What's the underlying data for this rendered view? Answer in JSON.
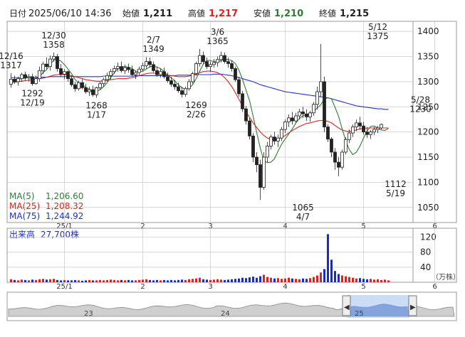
{
  "header": {
    "date_label": "日付",
    "date_value": "2025/06/10 14:36",
    "open_label": "始値",
    "open_value": "1,211",
    "high_label": "高値",
    "high_value": "1,217",
    "low_label": "安値",
    "low_value": "1,210",
    "close_label": "終値",
    "close_value": "1,215"
  },
  "colors": {
    "up": "#e0201c",
    "down": "#1a2dbf",
    "ma5": "#2e7d32",
    "ma25": "#e0201c",
    "ma75": "#2030d0",
    "grid": "#c8c8c8",
    "volume": "#e0201c",
    "volume_down": "#1a2dbf"
  },
  "legend": [
    {
      "label": "MA(5)",
      "value": "1,206.60",
      "color": "#2e7d32"
    },
    {
      "label": "MA(25)",
      "value": "1,208.32",
      "color": "#e0201c"
    },
    {
      "label": "MA(75)",
      "value": "1,244.92",
      "color": "#2030d0"
    }
  ],
  "price_axis": {
    "ticks": [
      "1400",
      "1350",
      "1300",
      "1250",
      "1200",
      "1150",
      "1100",
      "1050"
    ]
  },
  "month_labels": [
    "25/1",
    "2",
    "3",
    "4",
    "5",
    "6"
  ],
  "volume_panel": {
    "title": "出来高",
    "value": "27,700株",
    "ticks": [
      "120",
      "80",
      "40"
    ],
    "unit": "（万株）"
  },
  "navigator": {
    "labels": [
      "23",
      "24",
      "25"
    ]
  },
  "chart_data": {
    "type": "candlestick",
    "price_range": [
      1020,
      1420
    ],
    "volume_range": [
      0,
      140
    ],
    "months": [
      {
        "label": "25/1",
        "day": 15
      },
      {
        "label": "2",
        "day": 37
      },
      {
        "label": "3",
        "day": 56
      },
      {
        "label": "4",
        "day": 77
      },
      {
        "label": "5",
        "day": 99
      },
      {
        "label": "6",
        "day": 119
      }
    ],
    "annotations": [
      {
        "day": 0,
        "price": 1317,
        "text": [
          "12/16",
          "1317"
        ],
        "pos": "above"
      },
      {
        "day": 6,
        "price": 1292,
        "text": [
          "1292",
          "12/19"
        ],
        "pos": "below"
      },
      {
        "day": 12,
        "price": 1358,
        "text": [
          "12/30",
          "1358"
        ],
        "pos": "above"
      },
      {
        "day": 24,
        "price": 1268,
        "text": [
          "1268",
          "1/17"
        ],
        "pos": "below"
      },
      {
        "day": 40,
        "price": 1349,
        "text": [
          "2/7",
          "1349"
        ],
        "pos": "above"
      },
      {
        "day": 52,
        "price": 1269,
        "text": [
          "1269",
          "2/26"
        ],
        "pos": "below"
      },
      {
        "day": 58,
        "price": 1365,
        "text": [
          "3/6",
          "1365"
        ],
        "pos": "above"
      },
      {
        "day": 82,
        "price": 1065,
        "text": [
          "1065",
          "4/7"
        ],
        "pos": "below"
      },
      {
        "day": 103,
        "price": 1375,
        "text": [
          "5/12",
          "1375"
        ],
        "pos": "above"
      },
      {
        "day": 108,
        "price": 1112,
        "text": [
          "1112",
          "5/19"
        ],
        "pos": "below"
      },
      {
        "day": 115,
        "price": 1230,
        "text": [
          "5/28",
          "1230"
        ],
        "pos": "above"
      }
    ],
    "candles": [
      [
        1295,
        1317,
        1288,
        1305
      ],
      [
        1305,
        1312,
        1296,
        1300
      ],
      [
        1300,
        1310,
        1292,
        1306
      ],
      [
        1306,
        1318,
        1300,
        1314
      ],
      [
        1314,
        1320,
        1302,
        1308
      ],
      [
        1308,
        1315,
        1300,
        1310
      ],
      [
        1310,
        1316,
        1292,
        1296
      ],
      [
        1296,
        1312,
        1294,
        1306
      ],
      [
        1306,
        1330,
        1300,
        1322
      ],
      [
        1322,
        1340,
        1315,
        1335
      ],
      [
        1335,
        1348,
        1325,
        1330
      ],
      [
        1330,
        1352,
        1322,
        1345
      ],
      [
        1345,
        1358,
        1340,
        1350
      ],
      [
        1350,
        1355,
        1320,
        1326
      ],
      [
        1326,
        1335,
        1310,
        1315
      ],
      [
        1315,
        1325,
        1305,
        1320
      ],
      [
        1320,
        1322,
        1300,
        1306
      ],
      [
        1306,
        1312,
        1290,
        1294
      ],
      [
        1294,
        1300,
        1280,
        1286
      ],
      [
        1286,
        1302,
        1282,
        1298
      ],
      [
        1298,
        1305,
        1285,
        1288
      ],
      [
        1288,
        1296,
        1276,
        1280
      ],
      [
        1280,
        1290,
        1272,
        1284
      ],
      [
        1284,
        1292,
        1270,
        1274
      ],
      [
        1274,
        1290,
        1268,
        1288
      ],
      [
        1288,
        1300,
        1284,
        1296
      ],
      [
        1296,
        1308,
        1290,
        1304
      ],
      [
        1304,
        1318,
        1300,
        1312
      ],
      [
        1312,
        1325,
        1305,
        1320
      ],
      [
        1320,
        1332,
        1315,
        1326
      ],
      [
        1326,
        1338,
        1320,
        1330
      ],
      [
        1330,
        1340,
        1318,
        1322
      ],
      [
        1322,
        1334,
        1315,
        1328
      ],
      [
        1328,
        1336,
        1318,
        1324
      ],
      [
        1324,
        1332,
        1310,
        1314
      ],
      [
        1314,
        1322,
        1305,
        1318
      ],
      [
        1318,
        1330,
        1312,
        1325
      ],
      [
        1325,
        1338,
        1320,
        1332
      ],
      [
        1332,
        1349,
        1326,
        1340
      ],
      [
        1340,
        1348,
        1328,
        1334
      ],
      [
        1334,
        1340,
        1318,
        1322
      ],
      [
        1322,
        1330,
        1310,
        1314
      ],
      [
        1314,
        1326,
        1308,
        1320
      ],
      [
        1320,
        1328,
        1306,
        1310
      ],
      [
        1310,
        1318,
        1298,
        1302
      ],
      [
        1302,
        1310,
        1290,
        1295
      ],
      [
        1295,
        1304,
        1284,
        1290
      ],
      [
        1290,
        1298,
        1278,
        1282
      ],
      [
        1282,
        1290,
        1269,
        1275
      ],
      [
        1275,
        1290,
        1270,
        1286
      ],
      [
        1286,
        1305,
        1282,
        1300
      ],
      [
        1300,
        1320,
        1296,
        1316
      ],
      [
        1316,
        1340,
        1312,
        1336
      ],
      [
        1336,
        1365,
        1330,
        1352
      ],
      [
        1352,
        1360,
        1335,
        1340
      ],
      [
        1340,
        1348,
        1325,
        1330
      ],
      [
        1330,
        1340,
        1320,
        1334
      ],
      [
        1334,
        1345,
        1328,
        1338
      ],
      [
        1338,
        1350,
        1330,
        1344
      ],
      [
        1344,
        1360,
        1338,
        1352
      ],
      [
        1352,
        1358,
        1336,
        1340
      ],
      [
        1340,
        1348,
        1328,
        1336
      ],
      [
        1336,
        1342,
        1320,
        1326
      ],
      [
        1326,
        1330,
        1300,
        1304
      ],
      [
        1304,
        1310,
        1270,
        1276
      ],
      [
        1276,
        1282,
        1240,
        1246
      ],
      [
        1246,
        1252,
        1215,
        1222
      ],
      [
        1222,
        1228,
        1185,
        1192
      ],
      [
        1192,
        1198,
        1140,
        1150
      ],
      [
        1150,
        1160,
        1120,
        1135
      ],
      [
        1135,
        1145,
        1065,
        1090
      ],
      [
        1090,
        1160,
        1085,
        1150
      ],
      [
        1150,
        1180,
        1140,
        1172
      ],
      [
        1172,
        1195,
        1165,
        1190
      ],
      [
        1190,
        1200,
        1175,
        1182
      ],
      [
        1182,
        1195,
        1170,
        1188
      ],
      [
        1188,
        1210,
        1182,
        1205
      ],
      [
        1205,
        1225,
        1198,
        1220
      ],
      [
        1220,
        1235,
        1210,
        1228
      ],
      [
        1228,
        1240,
        1215,
        1222
      ],
      [
        1222,
        1238,
        1218,
        1232
      ],
      [
        1232,
        1246,
        1225,
        1240
      ],
      [
        1240,
        1250,
        1228,
        1236
      ],
      [
        1236,
        1245,
        1222,
        1230
      ],
      [
        1230,
        1242,
        1220,
        1238
      ],
      [
        1238,
        1260,
        1232,
        1255
      ],
      [
        1255,
        1290,
        1245,
        1280
      ],
      [
        1280,
        1375,
        1270,
        1300
      ],
      [
        1300,
        1310,
        1200,
        1210
      ],
      [
        1210,
        1215,
        1180,
        1186
      ],
      [
        1186,
        1190,
        1150,
        1160
      ],
      [
        1160,
        1168,
        1125,
        1140
      ],
      [
        1140,
        1150,
        1112,
        1130
      ],
      [
        1130,
        1165,
        1125,
        1160
      ],
      [
        1160,
        1190,
        1155,
        1185
      ],
      [
        1185,
        1205,
        1178,
        1198
      ],
      [
        1198,
        1215,
        1190,
        1210
      ],
      [
        1210,
        1225,
        1202,
        1218
      ],
      [
        1218,
        1230,
        1205,
        1212
      ],
      [
        1212,
        1220,
        1195,
        1200
      ],
      [
        1200,
        1210,
        1188,
        1195
      ],
      [
        1195,
        1204,
        1186,
        1200
      ],
      [
        1200,
        1210,
        1194,
        1205
      ],
      [
        1205,
        1212,
        1198,
        1208
      ],
      [
        1208,
        1217,
        1205,
        1215
      ]
    ],
    "ma5": [
      1302,
      1304,
      1305,
      1306,
      1307,
      1308,
      1306,
      1306,
      1310,
      1318,
      1324,
      1334,
      1343,
      1344,
      1341,
      1334,
      1325,
      1316,
      1304,
      1298,
      1294,
      1289,
      1285,
      1282,
      1281,
      1284,
      1290,
      1298,
      1308,
      1318,
      1326,
      1330,
      1330,
      1329,
      1326,
      1321,
      1320,
      1321,
      1325,
      1330,
      1331,
      1329,
      1326,
      1320,
      1313,
      1308,
      1301,
      1294,
      1288,
      1285,
      1287,
      1294,
      1306,
      1321,
      1335,
      1342,
      1342,
      1340,
      1339,
      1342,
      1344,
      1344,
      1342,
      1336,
      1323,
      1305,
      1283,
      1262,
      1231,
      1199,
      1168,
      1143,
      1139,
      1140,
      1147,
      1162,
      1176,
      1186,
      1196,
      1206,
      1218,
      1227,
      1232,
      1234,
      1236,
      1240,
      1248,
      1254,
      1266,
      1268,
      1266,
      1249,
      1231,
      1206,
      1183,
      1165,
      1155,
      1160,
      1172,
      1188,
      1202,
      1211,
      1212,
      1208,
      1204,
      1203,
      1207
    ],
    "ma25": [
      1298,
      1299,
      1300,
      1301,
      1302,
      1303,
      1304,
      1305,
      1306,
      1307,
      1309,
      1311,
      1313,
      1314,
      1314,
      1314,
      1313,
      1312,
      1310,
      1308,
      1306,
      1304,
      1303,
      1302,
      1301,
      1301,
      1302,
      1303,
      1304,
      1305,
      1306,
      1306,
      1306,
      1307,
      1308,
      1310,
      1312,
      1314,
      1316,
      1317,
      1317,
      1316,
      1315,
      1314,
      1313,
      1312,
      1311,
      1310,
      1310,
      1310,
      1311,
      1313,
      1315,
      1318,
      1320,
      1321,
      1321,
      1320,
      1318,
      1314,
      1308,
      1300,
      1290,
      1278,
      1265,
      1252,
      1240,
      1229,
      1218,
      1209,
      1200,
      1193,
      1188,
      1185,
      1184,
      1186,
      1189,
      1193,
      1198,
      1203,
      1207,
      1211,
      1214,
      1217,
      1218,
      1220,
      1222,
      1223,
      1223,
      1221,
      1218,
      1213,
      1208,
      1204,
      1202,
      1201,
      1202,
      1204,
      1206,
      1207,
      1208,
      1208,
      1208,
      1208,
      1208,
      1208,
      1208
    ],
    "ma75": [
      1308,
      1308,
      1308,
      1308,
      1308,
      1308,
      1308,
      1309,
      1309,
      1309,
      1309,
      1310,
      1310,
      1310,
      1310,
      1310,
      1310,
      1310,
      1310,
      1310,
      1310,
      1310,
      1310,
      1310,
      1310,
      1310,
      1311,
      1311,
      1311,
      1311,
      1311,
      1311,
      1311,
      1311,
      1311,
      1312,
      1312,
      1312,
      1312,
      1312,
      1312,
      1312,
      1312,
      1312,
      1312,
      1312,
      1312,
      1313,
      1313,
      1313,
      1313,
      1313,
      1314,
      1314,
      1314,
      1314,
      1314,
      1315,
      1315,
      1315,
      1314,
      1313,
      1312,
      1310,
      1308,
      1306,
      1304,
      1302,
      1300,
      1297,
      1294,
      1292,
      1290,
      1288,
      1286,
      1284,
      1282,
      1280,
      1279,
      1278,
      1277,
      1276,
      1275,
      1274,
      1273,
      1272,
      1271,
      1270,
      1269,
      1268,
      1266,
      1264,
      1262,
      1260,
      1258,
      1256,
      1254,
      1252,
      1251,
      1250,
      1249,
      1248,
      1247,
      1246,
      1246,
      1245,
      1245
    ],
    "volume": [
      8,
      6,
      5,
      7,
      6,
      5,
      7,
      6,
      8,
      9,
      7,
      8,
      9,
      6,
      5,
      6,
      5,
      5,
      6,
      5,
      4,
      5,
      6,
      5,
      5,
      6,
      5,
      6,
      7,
      6,
      5,
      6,
      5,
      6,
      5,
      5,
      6,
      7,
      8,
      6,
      5,
      6,
      5,
      6,
      5,
      6,
      5,
      6,
      7,
      6,
      8,
      9,
      10,
      12,
      8,
      7,
      6,
      7,
      8,
      7,
      6,
      7,
      8,
      9,
      10,
      12,
      11,
      13,
      15,
      12,
      16,
      20,
      14,
      12,
      10,
      11,
      9,
      10,
      12,
      10,
      9,
      8,
      10,
      9,
      11,
      14,
      18,
      26,
      35,
      128,
      60,
      30,
      22,
      18,
      16,
      14,
      12,
      10,
      11,
      9,
      8,
      9,
      7,
      8,
      6,
      7,
      5
    ]
  }
}
